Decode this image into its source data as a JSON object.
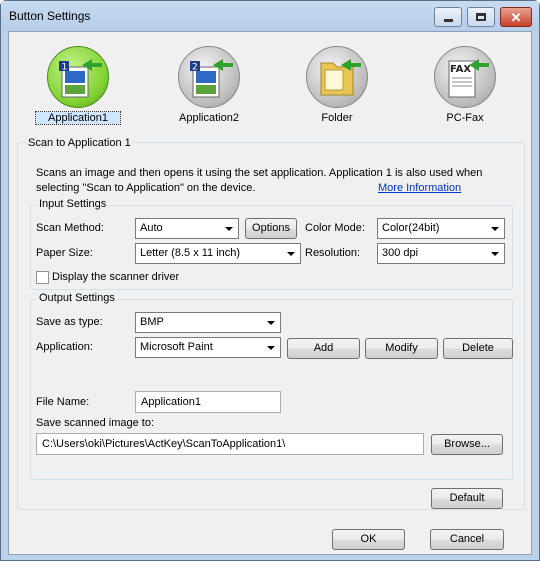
{
  "window": {
    "title": "Button Settings",
    "controls": {
      "minimize": "minimize-icon",
      "maximize": "maximize-icon",
      "close": "close-icon"
    }
  },
  "toolbar": {
    "items": [
      {
        "label": "Application1",
        "icon": "application-icon",
        "selected": true
      },
      {
        "label": "Application2",
        "icon": "application-icon",
        "selected": false
      },
      {
        "label": "Folder",
        "icon": "folder-icon",
        "selected": false
      },
      {
        "label": "PC-Fax",
        "icon": "fax-icon",
        "selected": false
      }
    ]
  },
  "scan_section": {
    "title": "Scan to Application 1",
    "description_line1": "Scans an image and then opens it using the set application. Application 1 is also used when",
    "description_line2": "selecting \"Scan to Application\" on the device.",
    "more_info_link": "More Information"
  },
  "input_settings": {
    "title": "Input Settings",
    "scan_method_label": "Scan Method:",
    "scan_method_value": "Auto",
    "options_button": "Options",
    "color_mode_label": "Color Mode:",
    "color_mode_value": "Color(24bit)",
    "paper_size_label": "Paper Size:",
    "paper_size_value": "Letter (8.5 x 11 inch)",
    "resolution_label": "Resolution:",
    "resolution_value": "300 dpi",
    "display_driver_label": "Display the scanner driver",
    "display_driver_checked": false
  },
  "output_settings": {
    "title": "Output Settings",
    "save_as_type_label": "Save as type:",
    "save_as_type_value": "BMP",
    "application_label": "Application:",
    "application_value": "Microsoft Paint",
    "add_button": "Add",
    "modify_button": "Modify",
    "delete_button": "Delete",
    "file_name_label": "File Name:",
    "file_name_value": "Application1",
    "save_path_label": "Save scanned image to:",
    "save_path_value": "C:\\Users\\oki\\Pictures\\ActKey\\ScanToApplication1\\",
    "browse_button": "Browse..."
  },
  "footer": {
    "default_button": "Default",
    "ok_button": "OK",
    "cancel_button": "Cancel"
  }
}
